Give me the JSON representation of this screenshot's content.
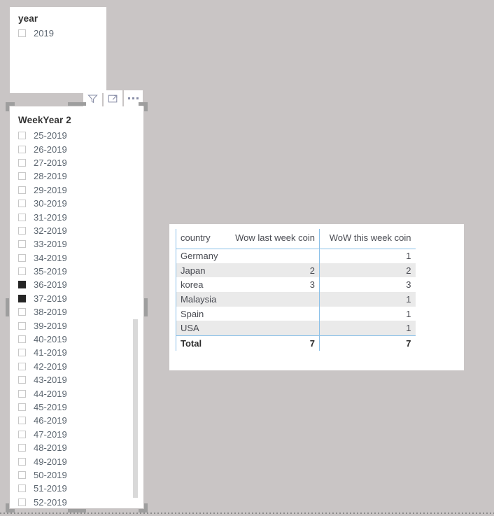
{
  "canvas": {
    "background_color": "#c9c5c5",
    "accent_color": "#8ac0e8"
  },
  "year_slicer": {
    "title": "year",
    "items": [
      {
        "label": "2019",
        "checked": false
      }
    ],
    "toolbar": [
      {
        "icon": "filter-icon",
        "label": "Filter"
      },
      {
        "icon": "focus-mode-icon",
        "label": "Focus mode"
      },
      {
        "icon": "more-options-icon",
        "label": "More options"
      }
    ]
  },
  "weekyear_slicer": {
    "title": "WeekYear 2",
    "items": [
      {
        "label": "25-2019",
        "checked": false
      },
      {
        "label": "26-2019",
        "checked": false
      },
      {
        "label": "27-2019",
        "checked": false
      },
      {
        "label": "28-2019",
        "checked": false
      },
      {
        "label": "29-2019",
        "checked": false
      },
      {
        "label": "30-2019",
        "checked": false
      },
      {
        "label": "31-2019",
        "checked": false
      },
      {
        "label": "32-2019",
        "checked": false
      },
      {
        "label": "33-2019",
        "checked": false
      },
      {
        "label": "34-2019",
        "checked": false
      },
      {
        "label": "35-2019",
        "checked": false
      },
      {
        "label": "36-2019",
        "checked": true
      },
      {
        "label": "37-2019",
        "checked": true
      },
      {
        "label": "38-2019",
        "checked": false
      },
      {
        "label": "39-2019",
        "checked": false
      },
      {
        "label": "40-2019",
        "checked": false
      },
      {
        "label": "41-2019",
        "checked": false
      },
      {
        "label": "42-2019",
        "checked": false
      },
      {
        "label": "43-2019",
        "checked": false
      },
      {
        "label": "44-2019",
        "checked": false
      },
      {
        "label": "45-2019",
        "checked": false
      },
      {
        "label": "46-2019",
        "checked": false
      },
      {
        "label": "47-2019",
        "checked": false
      },
      {
        "label": "48-2019",
        "checked": false
      },
      {
        "label": "49-2019",
        "checked": false
      },
      {
        "label": "50-2019",
        "checked": false
      },
      {
        "label": "51-2019",
        "checked": false
      },
      {
        "label": "52-2019",
        "checked": false
      }
    ]
  },
  "chart_data": {
    "type": "table",
    "title": "",
    "columns": [
      "country",
      "Wow last week coin",
      "WoW this week coin"
    ],
    "rows": [
      {
        "country": "Germany",
        "last_week": "",
        "this_week": "1"
      },
      {
        "country": "Japan",
        "last_week": "2",
        "this_week": "2"
      },
      {
        "country": "korea",
        "last_week": "3",
        "this_week": "3"
      },
      {
        "country": "Malaysia",
        "last_week": "",
        "this_week": "1"
      },
      {
        "country": "Spain",
        "last_week": "",
        "this_week": "1"
      },
      {
        "country": "USA",
        "last_week": "",
        "this_week": "1"
      }
    ],
    "total": {
      "country": "Total",
      "last_week": "7",
      "this_week": "7"
    }
  }
}
